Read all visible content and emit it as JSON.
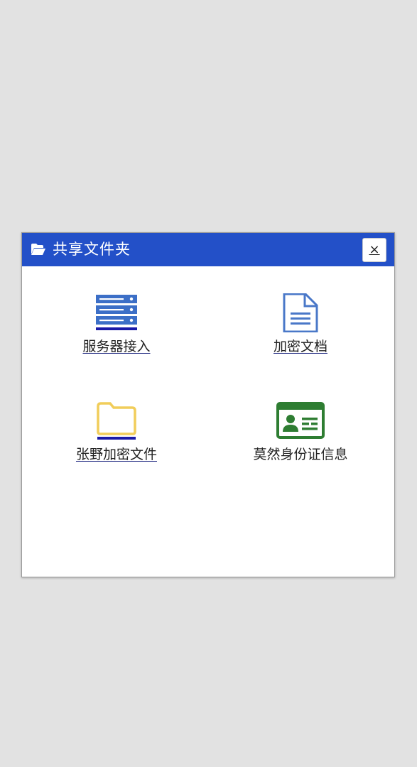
{
  "dialog": {
    "title": "共享文件夹",
    "title_icon": "folder-open-icon",
    "close_label": "×"
  },
  "items": [
    {
      "label": "服务器接入",
      "icon": "server-icon",
      "link": true,
      "color": "#3c6fc7"
    },
    {
      "label": "加密文档",
      "icon": "document-icon",
      "link": true,
      "color": "#4a78c8"
    },
    {
      "label": "张野加密文件",
      "icon": "folder-icon",
      "link": true,
      "color": "#f1cd5a"
    },
    {
      "label": "莫然身份证信息",
      "icon": "id-card-icon",
      "link": false,
      "color": "#2e7d32"
    }
  ],
  "colors": {
    "titlebar": "#2350c8",
    "link_underline": "#1a237e"
  }
}
